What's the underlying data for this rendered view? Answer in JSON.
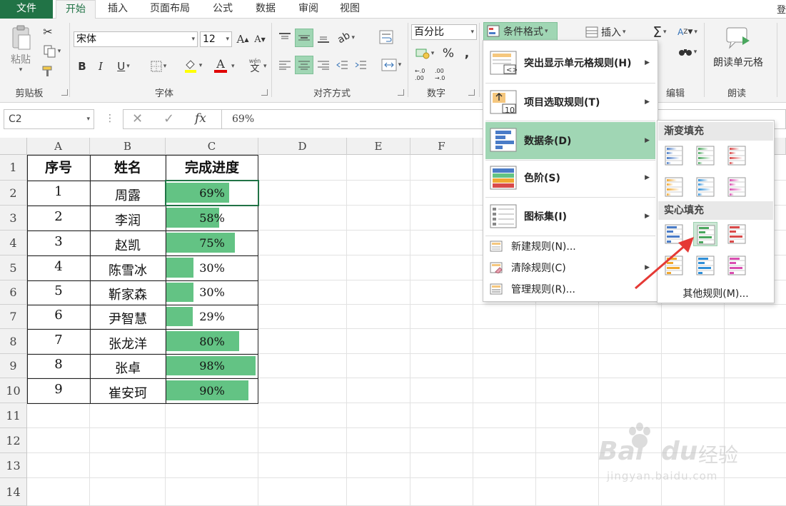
{
  "tabs": [
    {
      "label": "文件"
    },
    {
      "label": "开始"
    },
    {
      "label": "插入"
    },
    {
      "label": "页面布局"
    },
    {
      "label": "公式"
    },
    {
      "label": "数据"
    },
    {
      "label": "审阅"
    },
    {
      "label": "视图"
    }
  ],
  "tabbar_extra": "登",
  "ribbon": {
    "paste_label": "粘贴",
    "clipboard_label": "剪贴板",
    "font_name": "宋体",
    "font_size": "12",
    "font_label": "字体",
    "wen_label": "wén",
    "wen_char": "文",
    "align_label": "对齐方式",
    "number_format": "百分比",
    "number_label": "数字",
    "conditional_format_label": "条件格式",
    "insert_label": "插入",
    "edit_label": "编辑",
    "read_cell_label": "朗读单元格",
    "read_label": "朗读"
  },
  "formula_bar": {
    "name_box": "C2",
    "fx": "fx",
    "value": "69%"
  },
  "columns": [
    "A",
    "B",
    "C",
    "D",
    "E",
    "F"
  ],
  "rows": [
    "1",
    "2",
    "3",
    "4",
    "5",
    "6",
    "7",
    "8",
    "9",
    "10",
    "11",
    "12",
    "13",
    "14"
  ],
  "table": {
    "headers": [
      "序号",
      "姓名",
      "完成进度"
    ],
    "rows": [
      {
        "no": "1",
        "name": "周露",
        "pct_label": "69%",
        "pct": 0.69
      },
      {
        "no": "2",
        "name": "李润",
        "pct_label": "58%",
        "pct": 0.58
      },
      {
        "no": "3",
        "name": "赵凯",
        "pct_label": "75%",
        "pct": 0.75
      },
      {
        "no": "4",
        "name": "陈雪冰",
        "pct_label": "30%",
        "pct": 0.3
      },
      {
        "no": "5",
        "name": "靳家森",
        "pct_label": "30%",
        "pct": 0.3
      },
      {
        "no": "6",
        "name": "尹智慧",
        "pct_label": "29%",
        "pct": 0.29
      },
      {
        "no": "7",
        "name": "张龙洋",
        "pct_label": "80%",
        "pct": 0.8
      },
      {
        "no": "8",
        "name": "张卓",
        "pct_label": "98%",
        "pct": 0.98
      },
      {
        "no": "9",
        "name": "崔安珂",
        "pct_label": "90%",
        "pct": 0.9
      }
    ]
  },
  "cf_menu": {
    "items": [
      {
        "label": "突出显示单元格规则(H)"
      },
      {
        "label": "项目选取规则(T)"
      },
      {
        "label": "数据条(D)"
      },
      {
        "label": "色阶(S)"
      },
      {
        "label": "图标集(I)"
      }
    ],
    "small_items": [
      {
        "label": "新建规则(N)..."
      },
      {
        "label": "清除规则(C)"
      },
      {
        "label": "管理规则(R)..."
      }
    ],
    "top_icon_text": "10"
  },
  "databar_submenu": {
    "gradient_header": "渐变填充",
    "solid_header": "实心填充",
    "other_rules": "其他规则(M)...",
    "colors": [
      "#4a7cc7",
      "#4aa75e",
      "#d94a4a",
      "#f0a830",
      "#2f8fd8",
      "#d94fb0"
    ],
    "selected": "solid-green"
  },
  "colors": {
    "excel_green": "#217346",
    "databar_green": "#63c384",
    "menu_highlight": "#a0d6b4",
    "arrow_red": "#e53935"
  },
  "watermark": {
    "brand": "Bai",
    "brand2": "du",
    "jy": "经验",
    "url": "jingyan.baidu.com"
  }
}
